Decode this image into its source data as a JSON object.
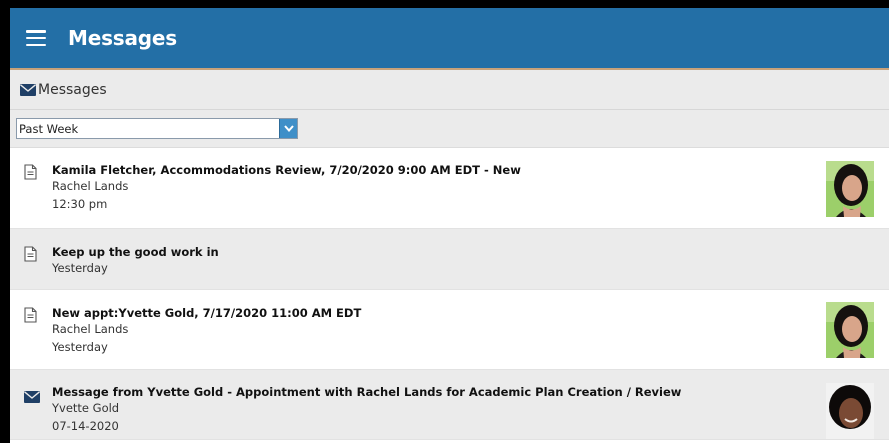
{
  "header": {
    "title": "Messages",
    "menu_icon": "hamburger-menu-icon"
  },
  "subheader": {
    "title": "Messages",
    "icon": "envelope-icon"
  },
  "filter": {
    "selected": "Past Week"
  },
  "messages": [
    {
      "title": "Kamila Fletcher, Accommodations Review, 7/20/2020 9:00 AM EDT - New",
      "from": "Rachel Lands",
      "time": "12:30 pm",
      "icon": "document-icon",
      "has_avatar": true
    },
    {
      "title": "Keep up the good work in",
      "from": "",
      "time": "Yesterday",
      "icon": "document-icon",
      "has_avatar": false
    },
    {
      "title": "New appt:Yvette Gold, 7/17/2020 11:00 AM EDT",
      "from": "Rachel Lands",
      "time": "Yesterday",
      "icon": "document-icon",
      "has_avatar": true
    },
    {
      "title": "Message from Yvette Gold - Appointment with Rachel Lands for Academic Plan Creation / Review",
      "from": "Yvette Gold",
      "time": "07-14-2020",
      "icon": "envelope-icon",
      "has_avatar": true
    }
  ],
  "colors": {
    "header_bg": "#236fa6",
    "accent_line": "#c8a27a",
    "row_alt": "#ebebeb"
  }
}
